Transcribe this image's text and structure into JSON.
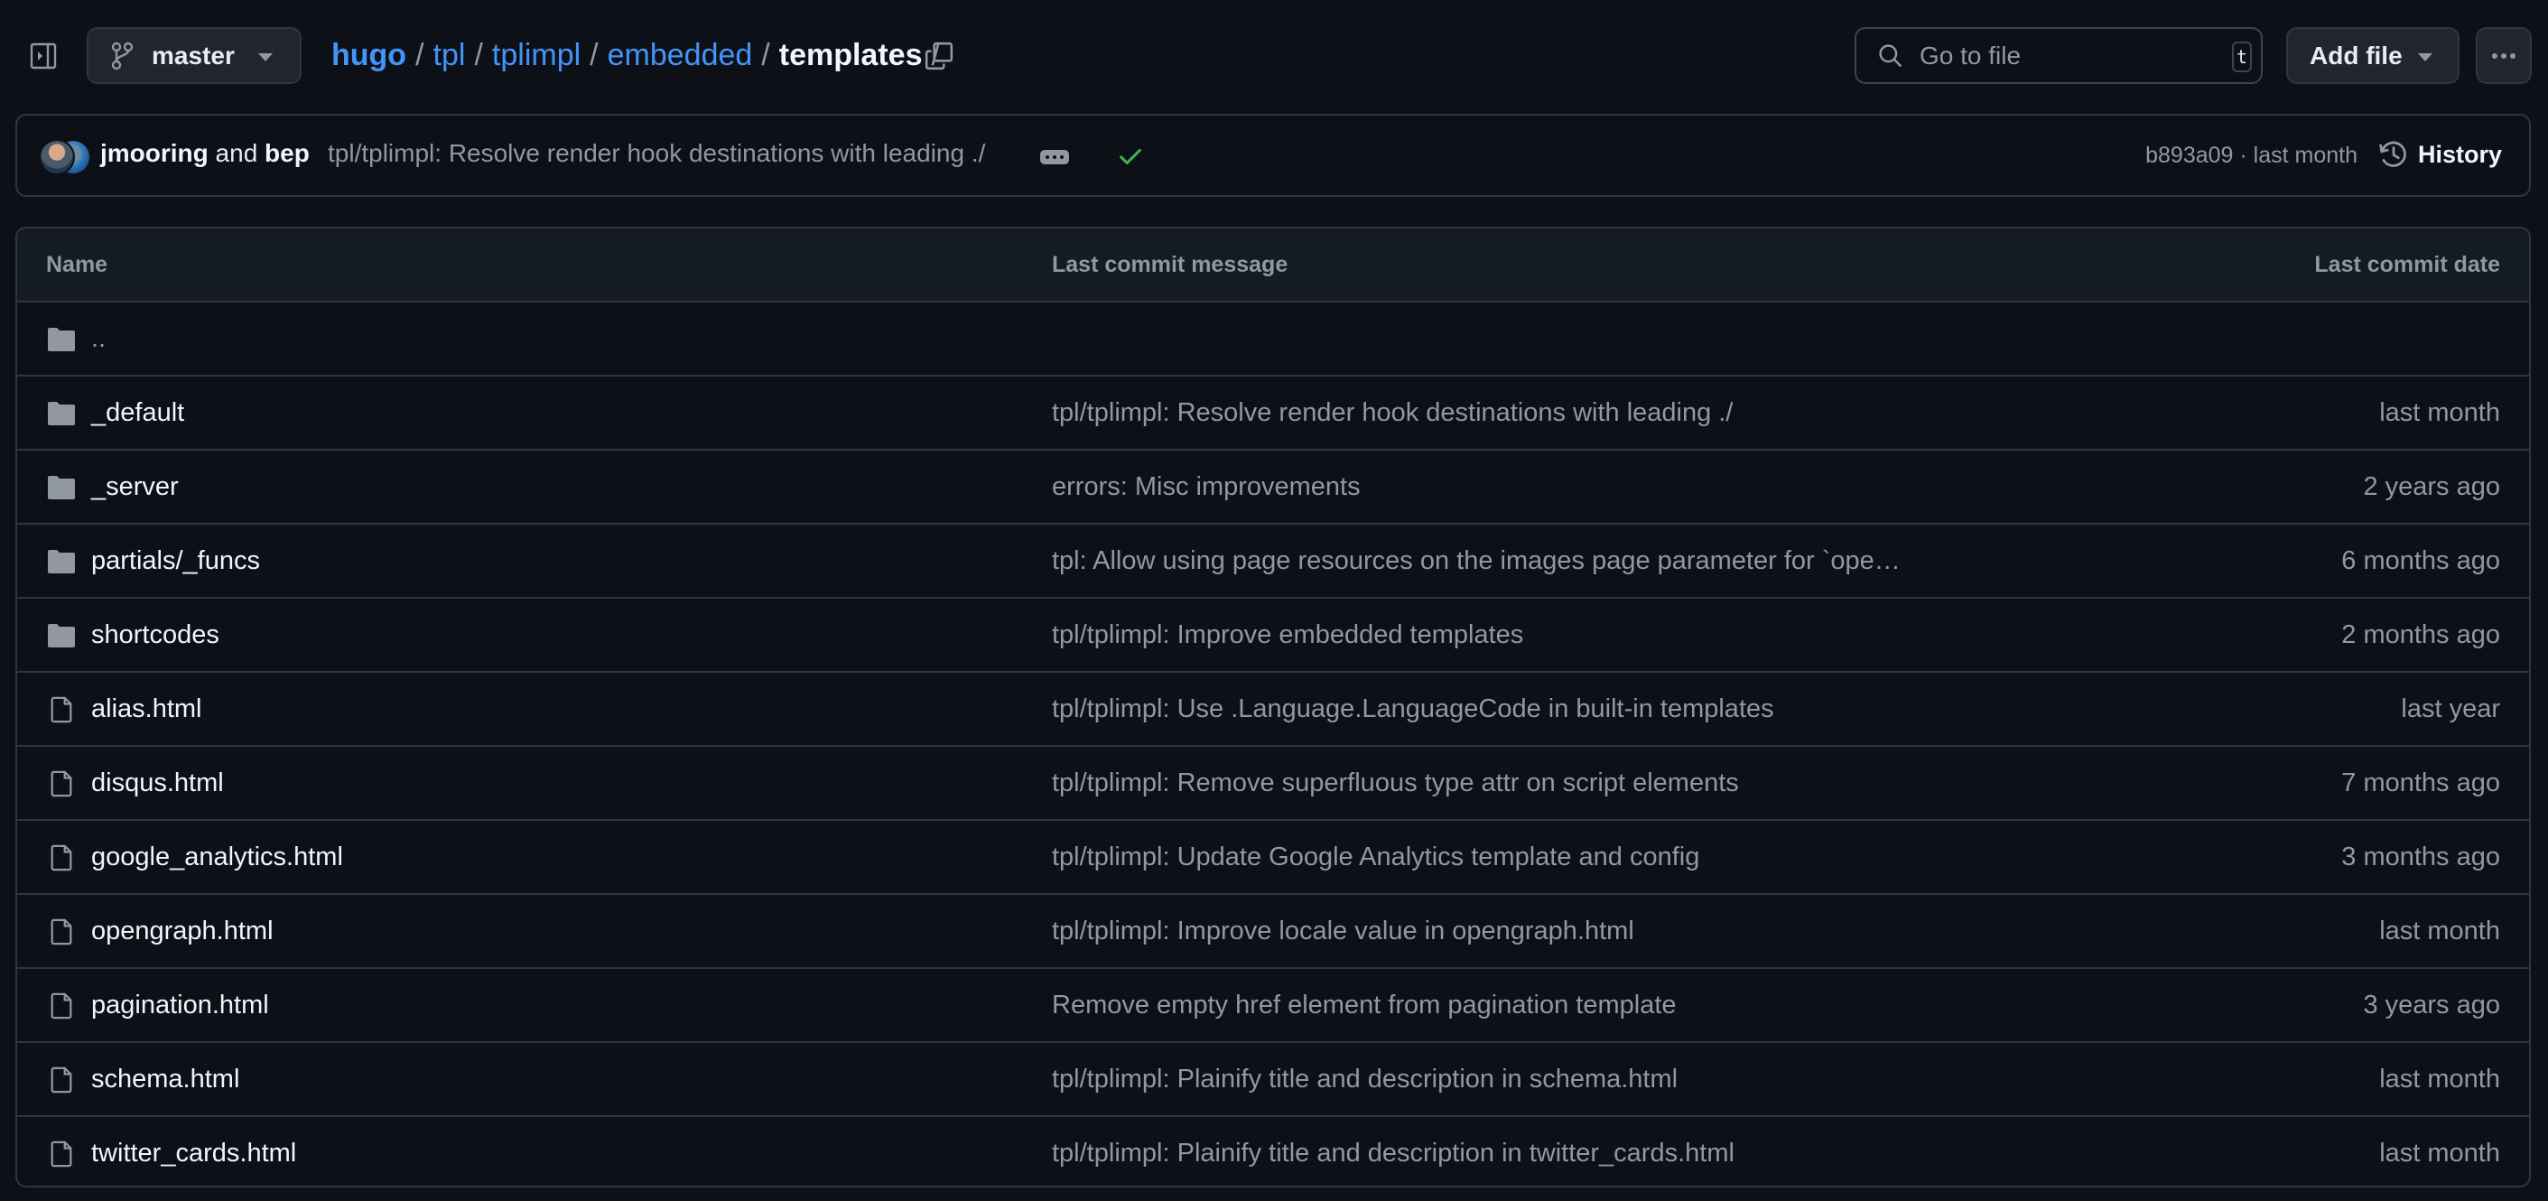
{
  "topbar": {
    "branch": "master",
    "breadcrumb": [
      {
        "label": "hugo"
      },
      {
        "label": "tpl"
      },
      {
        "label": "tplimpl"
      },
      {
        "label": "embedded"
      }
    ],
    "current_folder": "templates",
    "separator": "/",
    "search_placeholder": "Go to file",
    "search_shortcut": "t",
    "add_file_label": "Add file"
  },
  "commit": {
    "author1": "jmooring",
    "conjunction": "and",
    "author2": "bep",
    "message": "tpl/tplimpl: Resolve render hook destinations with leading ./",
    "status": "success",
    "sha": "b893a09",
    "meta_sep": "·",
    "time": "last month",
    "meta": "b893a09 · last month",
    "history_label": "History"
  },
  "table": {
    "headers": {
      "name": "Name",
      "message": "Last commit message",
      "date": "Last commit date"
    },
    "parent_dir": "..",
    "rows": [
      {
        "type": "folder",
        "name": "_default",
        "message": "tpl/tplimpl: Resolve render hook destinations with leading ./",
        "date": "last month"
      },
      {
        "type": "folder",
        "name": "_server",
        "message": "errors: Misc improvements",
        "date": "2 years ago"
      },
      {
        "type": "folder",
        "name": "partials/_funcs",
        "message": "tpl: Allow using page resources on the images page parameter for `ope…",
        "date": "6 months ago"
      },
      {
        "type": "folder",
        "name": "shortcodes",
        "message": "tpl/tplimpl: Improve embedded templates",
        "date": "2 months ago"
      },
      {
        "type": "file",
        "name": "alias.html",
        "message": "tpl/tplimpl: Use .Language.LanguageCode in built-in templates",
        "date": "last year"
      },
      {
        "type": "file",
        "name": "disqus.html",
        "message": "tpl/tplimpl: Remove superfluous type attr on script elements",
        "date": "7 months ago"
      },
      {
        "type": "file",
        "name": "google_analytics.html",
        "message": "tpl/tplimpl: Update Google Analytics template and config",
        "date": "3 months ago"
      },
      {
        "type": "file",
        "name": "opengraph.html",
        "message": "tpl/tplimpl: Improve locale value in opengraph.html",
        "date": "last month"
      },
      {
        "type": "file",
        "name": "pagination.html",
        "message": "Remove empty href element from pagination template",
        "date": "3 years ago"
      },
      {
        "type": "file",
        "name": "schema.html",
        "message": "tpl/tplimpl: Plainify title and description in schema.html",
        "date": "last month"
      },
      {
        "type": "file",
        "name": "twitter_cards.html",
        "message": "tpl/tplimpl: Plainify title and description in twitter_cards.html",
        "date": "last month"
      }
    ]
  },
  "colors": {
    "background": "#0d1117",
    "link": "#4493f8",
    "muted": "#9198a1",
    "border": "#30363d",
    "success": "#3fb950"
  }
}
